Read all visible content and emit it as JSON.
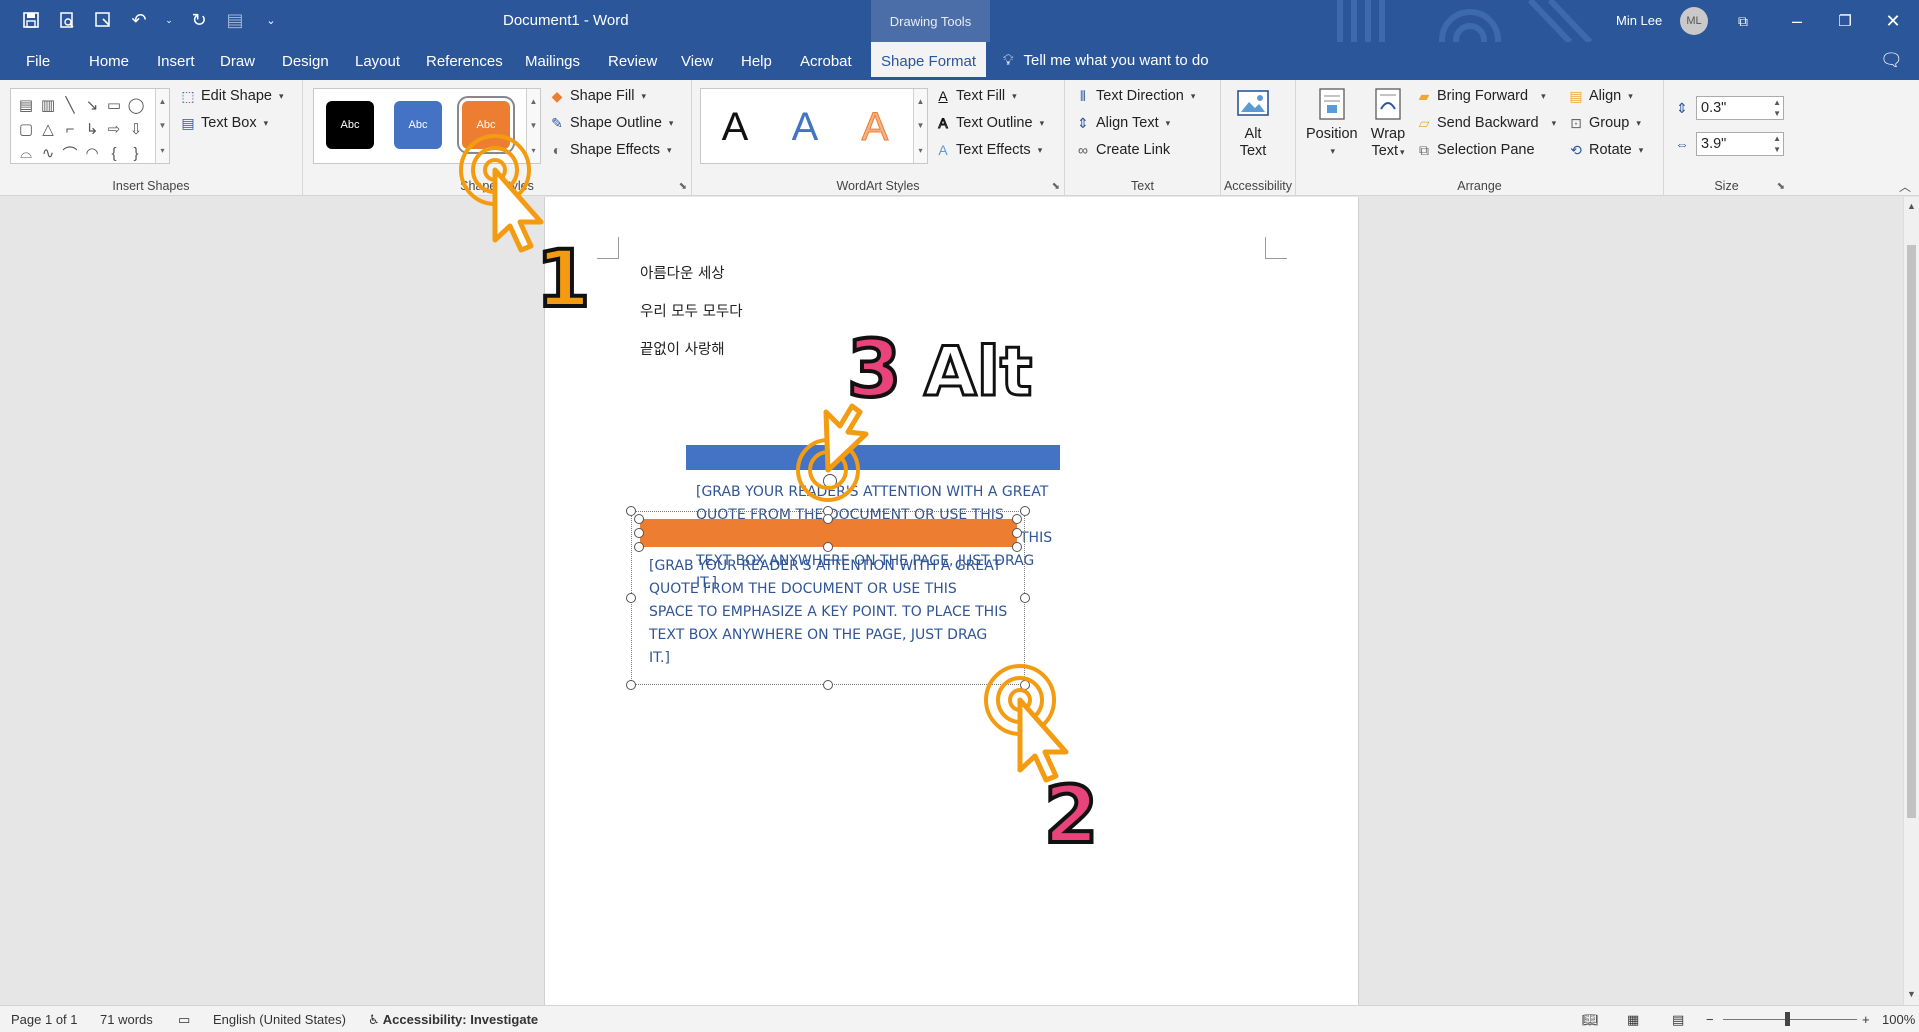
{
  "window": {
    "doc_title": "Document1  -  Word",
    "contextual_tab_group": "Drawing Tools",
    "user_name": "Min Lee",
    "user_initials": "ML"
  },
  "tabs": [
    "File",
    "Home",
    "Insert",
    "Draw",
    "Design",
    "Layout",
    "References",
    "Mailings",
    "Review",
    "View",
    "Help",
    "Acrobat",
    "Shape Format"
  ],
  "active_tab": "Shape Format",
  "tell_me": "Tell me what you want to do",
  "ribbon": {
    "insert_shapes": {
      "label": "Insert Shapes",
      "edit_shape": "Edit Shape",
      "text_box": "Text Box"
    },
    "shape_styles": {
      "label": "Shape Styles",
      "swatch_text": "Abc",
      "swatch_colors": [
        "#000000",
        "#4472c4",
        "#ed7d31"
      ],
      "shape_fill": "Shape Fill",
      "shape_outline": "Shape Outline",
      "shape_effects": "Shape Effects"
    },
    "wordart": {
      "label": "WordArt Styles",
      "letter": "A",
      "text_fill": "Text Fill",
      "text_outline": "Text Outline",
      "text_effects": "Text Effects"
    },
    "text": {
      "label": "Text",
      "text_direction": "Text Direction",
      "align_text": "Align Text",
      "create_link": "Create Link"
    },
    "accessibility": {
      "label": "Accessibility",
      "alt_text_1": "Alt",
      "alt_text_2": "Text"
    },
    "arrange": {
      "label": "Arrange",
      "position": "Position",
      "wrap_text_1": "Wrap",
      "wrap_text_2": "Text",
      "bring_forward": "Bring Forward",
      "send_backward": "Send Backward",
      "selection_pane": "Selection Pane",
      "align": "Align",
      "group": "Group",
      "rotate": "Rotate"
    },
    "size": {
      "label": "Size",
      "height": "0.3\"",
      "width": "3.9\""
    }
  },
  "document": {
    "lines": [
      "아름다운 세상",
      "우리 모두 모두다",
      "끝없이 사랑해"
    ],
    "quote_top_1": "[GRAB YOUR READER'S ATTENTION WITH A GREAT",
    "quote_top_2": "QUOTE FROM THE DOCUMENT OR USE THIS",
    "quote_top_3": "THIS",
    "quote_top_4": "TEXT BOX ANYWHERE ON THE PAGE, JUST DRAG",
    "quote_top_5": "IT.]",
    "quote_main": [
      "[GRAB YOUR READER'S ATTENTION WITH A GREAT",
      "QUOTE FROM THE DOCUMENT OR USE THIS",
      "SPACE TO EMPHASIZE A KEY POINT. TO PLACE THIS",
      "TEXT BOX ANYWHERE ON THE PAGE, JUST DRAG",
      "IT.]"
    ],
    "colors": {
      "blue_bar": "#4472c4",
      "orange_bar": "#ed7d31",
      "quote_text": "#2f5597"
    }
  },
  "annotations": {
    "step1": "1",
    "step2": "2",
    "step3": "3",
    "alt_key": "Alt",
    "accent": "#f39c12"
  },
  "status": {
    "page": "Page 1 of 1",
    "words": "71 words",
    "language": "English (United States)",
    "accessibility": "Accessibility: Investigate",
    "zoom": "100%",
    "zoom_minus": "−",
    "zoom_plus": "+"
  }
}
